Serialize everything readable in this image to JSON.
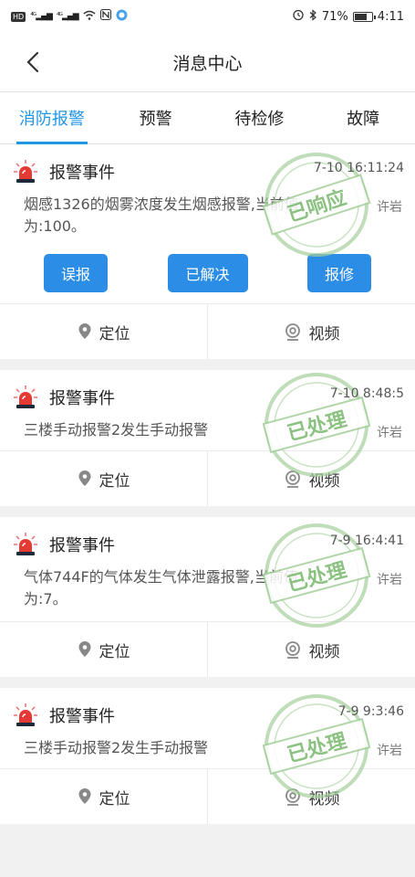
{
  "status_bar": {
    "hd": "HD",
    "net1": "⁴ᴳ",
    "net2": "⁴ᴳ",
    "battery_pct": "71%",
    "battery_level": 0.71,
    "time": "4:11"
  },
  "nav": {
    "title": "消息中心"
  },
  "tabs": [
    {
      "label": "消防报警",
      "active": true
    },
    {
      "label": "预警",
      "active": false
    },
    {
      "label": "待检修",
      "active": false
    },
    {
      "label": "故障",
      "active": false
    }
  ],
  "footer_labels": {
    "locate": "定位",
    "video": "视频"
  },
  "cards": [
    {
      "title": "报警事件",
      "time": "7-10 16:11:24",
      "message": "烟感1326的烟雾浓度发生烟感报警,当前值为:100。",
      "person": "许岩",
      "stamp": "已响应",
      "actions": [
        "误报",
        "已解决",
        "报修"
      ]
    },
    {
      "title": "报警事件",
      "time": "7-10 8:48:5",
      "message": "三楼手动报警2发生手动报警",
      "person": "许岩",
      "stamp": "已处理"
    },
    {
      "title": "报警事件",
      "time": "7-9 16:4:41",
      "message": "气体744F的气体发生气体泄露报警,当前值为:7。",
      "person": "许岩",
      "stamp": "已处理"
    },
    {
      "title": "报警事件",
      "time": "7-9 9:3:46",
      "message": "三楼手动报警2发生手动报警",
      "person": "许岩",
      "stamp": "已处理"
    }
  ]
}
